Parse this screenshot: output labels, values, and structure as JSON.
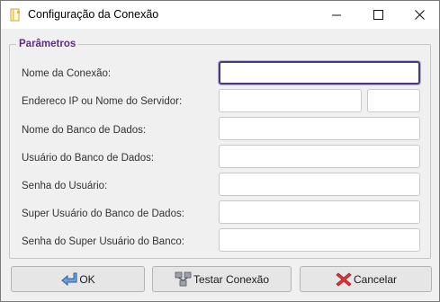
{
  "window": {
    "title": "Configuração da Conexão",
    "icons": {
      "app": "app-window-icon",
      "minimize": "minimize-icon",
      "maximize": "maximize-icon",
      "close": "close-icon"
    }
  },
  "group": {
    "legend": "Parâmetros"
  },
  "fields": [
    {
      "label": "Nome da Conexão:",
      "value": ""
    },
    {
      "label": "Endereco IP ou Nome do Servidor:",
      "value": "",
      "port_value": ""
    },
    {
      "label": "Nome do Banco de Dados:",
      "value": ""
    },
    {
      "label": "Usuário do Banco de Dados:",
      "value": ""
    },
    {
      "label": "Senha do Usuário:",
      "value": ""
    },
    {
      "label": "Super Usuário do Banco de Dados:",
      "value": ""
    },
    {
      "label": "Senha do Super Usuário do Banco:",
      "value": ""
    }
  ],
  "buttons": {
    "ok": {
      "label": "OK",
      "icon": "ok-arrow-icon"
    },
    "test": {
      "label": "Testar Conexão",
      "icon": "network-test-icon"
    },
    "cancel": {
      "label": "Cancelar",
      "icon": "cancel-x-icon"
    }
  },
  "colors": {
    "legend": "#5b2f7c",
    "focus_border": "#4b3a7a",
    "cancel_icon": "#d9262b",
    "ok_icon": "#3b6fb6"
  }
}
